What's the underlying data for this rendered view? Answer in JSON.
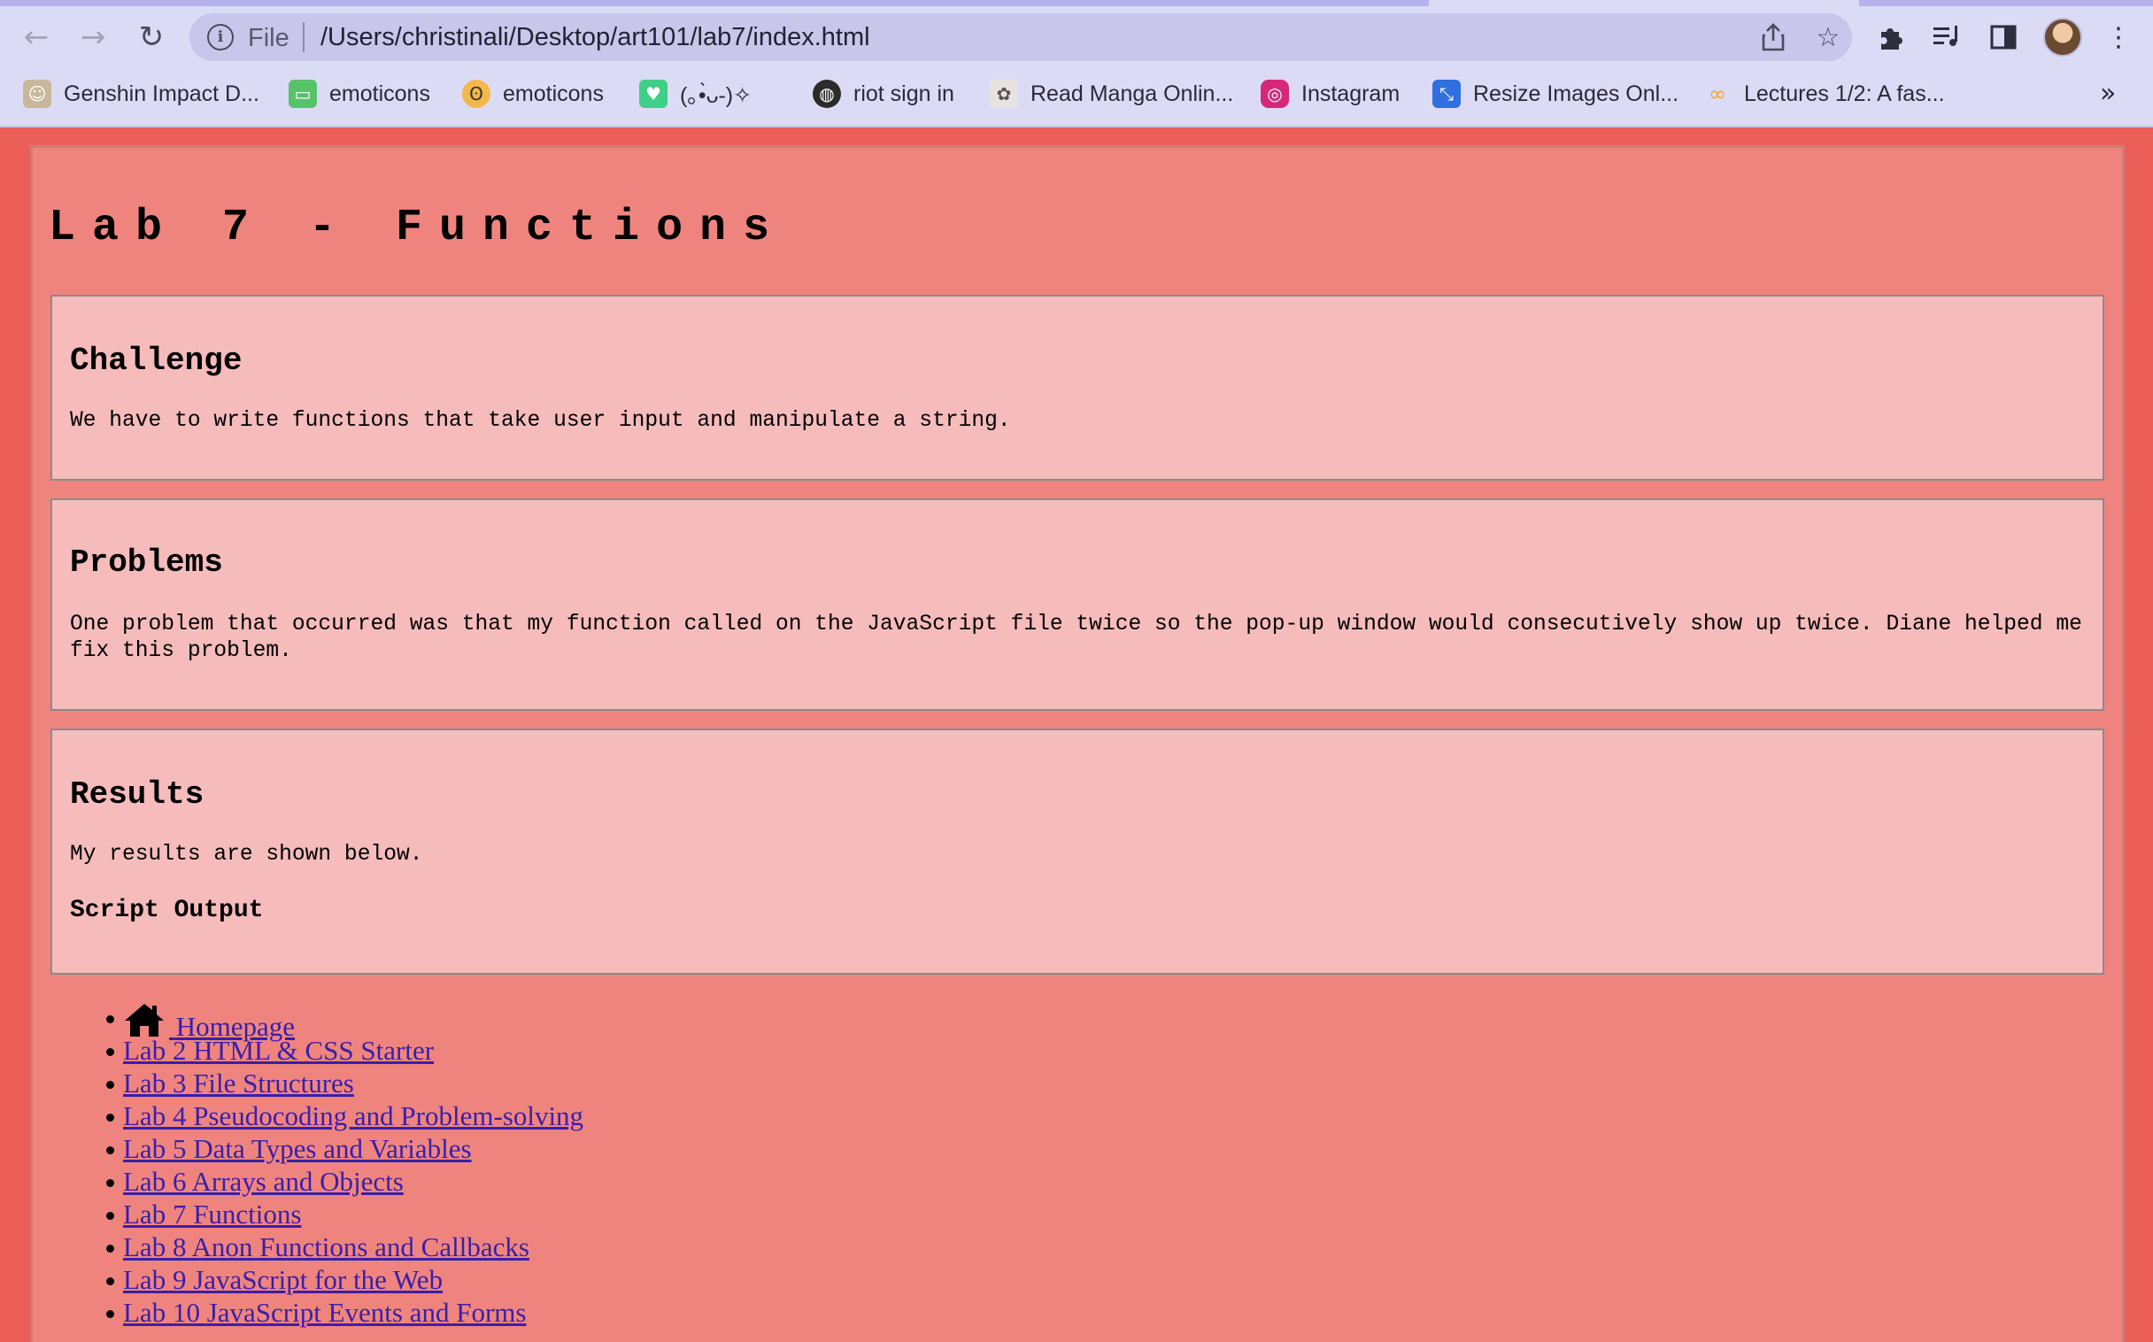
{
  "browser": {
    "omnibox": {
      "scheme_label": "File",
      "url": "/Users/christinali/Desktop/art101/lab7/index.html"
    },
    "icons": {
      "back": "back-arrow-icon",
      "forward": "forward-arrow-icon",
      "reload": "reload-icon",
      "info": "info-icon",
      "share": "share-icon",
      "bookmark_star": "star-icon",
      "extensions": "puzzle-icon",
      "media": "media-queue-icon",
      "side_panel": "side-panel-icon",
      "menu": "kebab-menu-icon"
    },
    "bookmarks": [
      {
        "label": "Genshin Impact D...",
        "icon": "genshin-icon",
        "color": "#c9b79a"
      },
      {
        "label": "emoticons",
        "icon": "chat-icon",
        "color": "#58c26b"
      },
      {
        "label": "emoticons",
        "icon": "face-icon",
        "color": "#f2b84a"
      },
      {
        "label": "(｡•̀ᴗ-)✧",
        "icon": "heart-icon",
        "color": "#3fcf88"
      },
      {
        "label": "riot sign in",
        "icon": "globe-icon",
        "color": "#2b2b2b"
      },
      {
        "label": "Read Manga Onlin...",
        "icon": "manga-icon",
        "color": "#e8e3e0"
      },
      {
        "label": "Instagram",
        "icon": "instagram-icon",
        "color": "#d6287a"
      },
      {
        "label": "Resize Images Onl...",
        "icon": "resize-icon",
        "color": "#2f6fe0"
      },
      {
        "label": "Lectures 1/2: A fas...",
        "icon": "coursera-icon",
        "color": "#f5a623"
      }
    ],
    "bookmarks_overflow": "»"
  },
  "page": {
    "title": "Lab 7 - Functions",
    "sections": [
      {
        "heading": "Challenge",
        "text": "We have to write functions that take user input and manipulate a string."
      },
      {
        "heading": "Problems",
        "text": "One problem that occurred was that my function called on the JavaScript file twice so the pop-up window would consecutively show up twice. Diane helped me fix this problem."
      },
      {
        "heading": "Results",
        "text": "My results are shown below.",
        "subheading": "Script Output"
      }
    ],
    "nav_links": [
      {
        "label": " Homepage",
        "icon": "home-icon"
      },
      {
        "label": "Lab 2 HTML & CSS Starter"
      },
      {
        "label": "Lab 3 File Structures"
      },
      {
        "label": "Lab 4 Pseudocoding and Problem-solving"
      },
      {
        "label": "Lab 5 Data Types and Variables"
      },
      {
        "label": "Lab 6 Arrays and Objects"
      },
      {
        "label": "Lab 7 Functions"
      },
      {
        "label": "Lab 8 Anon Functions and Callbacks"
      },
      {
        "label": "Lab 9 JavaScript for the Web"
      },
      {
        "label": "Lab 10 JavaScript Events and Forms"
      }
    ]
  },
  "colors": {
    "page_background": "#ec5f58",
    "container_background": "#ef847f",
    "card_background": "#f5bcbb",
    "link": "#3a1fa8",
    "browser_chrome": "#dcdbf5"
  }
}
